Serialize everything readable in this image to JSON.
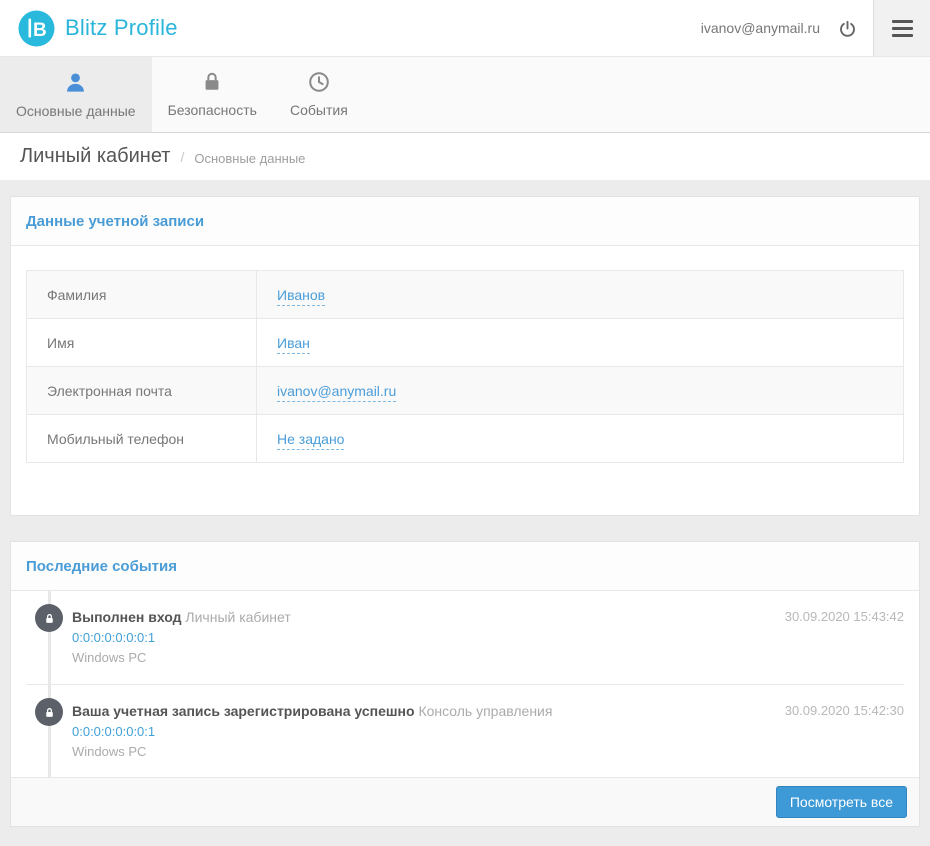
{
  "header": {
    "brand": "Blitz Profile",
    "user_email": "ivanov@anymail.ru"
  },
  "tabs": [
    {
      "label": "Основные данные",
      "icon": "user-icon",
      "active": true
    },
    {
      "label": "Безопасность",
      "icon": "lock-icon",
      "active": false
    },
    {
      "label": "События",
      "icon": "clock-icon",
      "active": false
    }
  ],
  "breadcrumb": {
    "title": "Личный кабинет",
    "separator": "/",
    "section": "Основные данные"
  },
  "account_card": {
    "title": "Данные учетной записи",
    "rows": [
      {
        "label": "Фамилия",
        "value": "Иванов"
      },
      {
        "label": "Имя",
        "value": "Иван"
      },
      {
        "label": "Электронная почта",
        "value": "ivanov@anymail.ru"
      },
      {
        "label": "Мобильный телефон",
        "value": "Не задано"
      }
    ]
  },
  "events_card": {
    "title": "Последние события",
    "events": [
      {
        "title": "Выполнен вход",
        "context": "Личный кабинет",
        "ip": "0:0:0:0:0:0:0:1",
        "device": "Windows PC",
        "timestamp": "30.09.2020 15:43:42"
      },
      {
        "title": "Ваша учетная запись зарегистрирована успешно",
        "context": "Консоль управления",
        "ip": "0:0:0:0:0:0:0:1",
        "device": "Windows PC",
        "timestamp": "30.09.2020 15:42:30"
      }
    ],
    "view_all_label": "Посмотреть все"
  },
  "colors": {
    "brand_cyan": "#2ab5da",
    "accent_blue": "#4a9dd9",
    "active_icon_blue": "#4a90d9",
    "button_blue": "#3d9ad6",
    "event_icon_bg": "#5b6069",
    "page_bg": "#ececec"
  }
}
